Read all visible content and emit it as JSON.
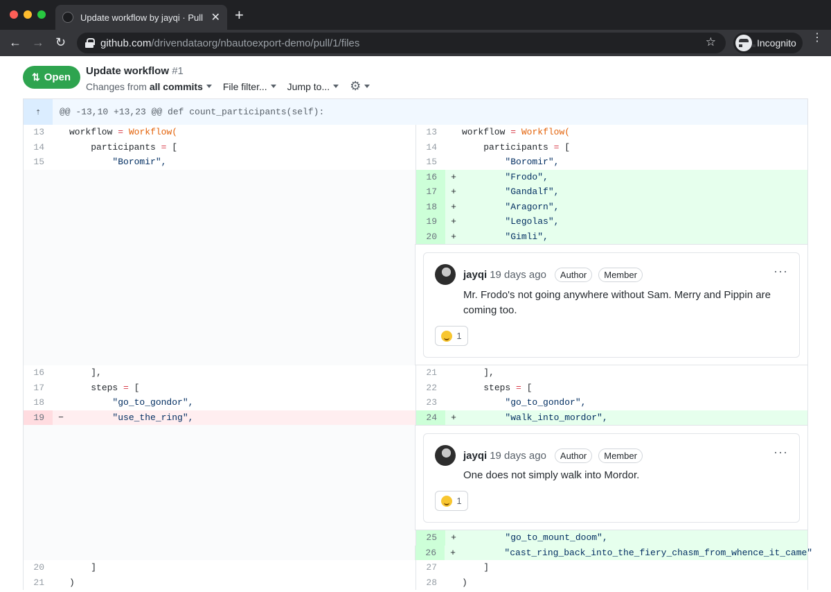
{
  "browser": {
    "tab_title": "Update workflow by jayqi · Pull",
    "url_host": "github.com",
    "url_path": "/drivendataorg/nbautoexport-demo/pull/1/files",
    "profile_label": "Incognito"
  },
  "pr": {
    "state": "Open",
    "title": "Update workflow",
    "number": "#1",
    "changes_prefix": "Changes from",
    "changes_scope": "all commits",
    "file_filter": "File filter...",
    "jump_to": "Jump to..."
  },
  "diff": {
    "hunk_header": "@@ -13,10 +13,23 @@ def count_participants(self):",
    "block1": [
      {
        "l": "13",
        "r": "13"
      },
      {
        "l": "14",
        "r": "14"
      },
      {
        "l": "15",
        "r": "15"
      }
    ],
    "block1_code": {
      "workflow_var": "workflow",
      "eq": "=",
      "workflow_fn": "Workflow(",
      "participants": "participants",
      "open_bracket": "[",
      "boromir": "\"Boromir\","
    },
    "added1": [
      {
        "r": "16",
        "code": "\"Frodo\","
      },
      {
        "r": "17",
        "code": "\"Gandalf\","
      },
      {
        "r": "18",
        "code": "\"Aragorn\","
      },
      {
        "r": "19",
        "code": "\"Legolas\","
      },
      {
        "r": "20",
        "code": "\"Gimli\","
      }
    ],
    "block2": [
      {
        "l": "16",
        "r": "21",
        "code": "],"
      },
      {
        "l": "17",
        "r": "22",
        "code": "steps"
      },
      {
        "l": "18",
        "r": "23",
        "code": "\"go_to_gondor\","
      }
    ],
    "del_line": {
      "l": "19",
      "code": "\"use_the_ring\","
    },
    "add_line": {
      "r": "24",
      "code": "\"walk_into_mordor\","
    },
    "added2": [
      {
        "r": "25",
        "code": "\"go_to_mount_doom\","
      },
      {
        "r": "26",
        "code": "\"cast_ring_back_into_the_fiery_chasm_from_whence_it_came\""
      }
    ],
    "block3": [
      {
        "l": "20",
        "r": "27",
        "code": "]"
      },
      {
        "l": "21",
        "r": "28",
        "code": ")"
      }
    ],
    "plus": "+",
    "minus": "−"
  },
  "comments": [
    {
      "author": "jayqi",
      "time": "19 days ago",
      "badge1": "Author",
      "badge2": "Member",
      "body": "Mr. Frodo's not going anywhere without Sam. Merry and Pippin are coming too.",
      "reaction_count": "1"
    },
    {
      "author": "jayqi",
      "time": "19 days ago",
      "badge1": "Author",
      "badge2": "Member",
      "body": "One does not simply walk into Mordor.",
      "reaction_count": "1"
    }
  ]
}
